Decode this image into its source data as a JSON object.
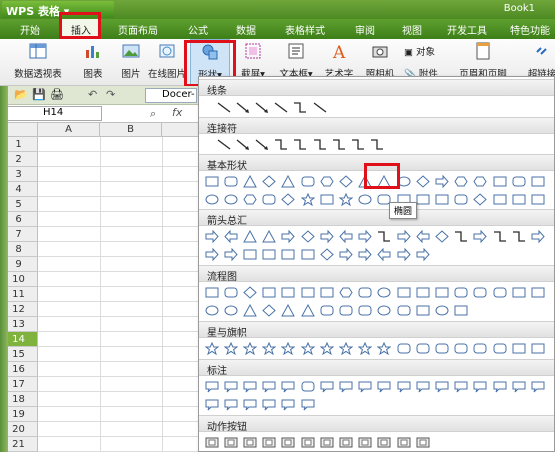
{
  "titlebar": {
    "app": "WPS 表格",
    "book": "Book1"
  },
  "menu": {
    "items": [
      "开始",
      "插入",
      "页面布局",
      "公式",
      "数据",
      "表格样式",
      "审阅",
      "视图",
      "开发工具",
      "特色功能"
    ]
  },
  "toolbar": {
    "pivot": "数据透视表",
    "chart": "图表",
    "picture": "图片",
    "online_pic": "在线图片",
    "shape": "形状",
    "screenshot": "截屏",
    "textbox": "文本框",
    "wordart": "艺术字",
    "camera": "照相机",
    "object": "对象",
    "attachment": "附件",
    "header_footer": "页眉和页脚",
    "hyperlink": "超链接"
  },
  "quickbar": {
    "doc_tab": "Docer-"
  },
  "formulabar": {
    "cell_ref": "H14",
    "fx": "fx"
  },
  "grid": {
    "columns": [
      "A",
      "B"
    ],
    "rows": [
      "1",
      "2",
      "3",
      "4",
      "5",
      "6",
      "7",
      "8",
      "9",
      "10",
      "11",
      "12",
      "13",
      "14",
      "15",
      "16",
      "17",
      "18",
      "19",
      "20",
      "21"
    ],
    "selected_row": "14"
  },
  "shapes": {
    "sections": [
      "线条",
      "连接符",
      "基本形状",
      "箭头总汇",
      "流程图",
      "星与旗帜",
      "标注",
      "动作按钮"
    ],
    "tooltip": "椭圆"
  }
}
